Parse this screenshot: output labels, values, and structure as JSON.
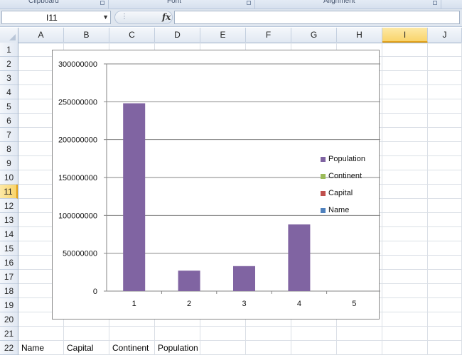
{
  "ribbon": {
    "groups": [
      {
        "label": "Clipboard"
      },
      {
        "label": "Font"
      },
      {
        "label": "Alignment"
      }
    ]
  },
  "formula_bar": {
    "name_box": "I11",
    "fx_label": "fx",
    "formula": ""
  },
  "sheet": {
    "columns": [
      "A",
      "B",
      "C",
      "D",
      "E",
      "F",
      "G",
      "H",
      "I",
      "J"
    ],
    "active_column": "I",
    "rows": [
      "1",
      "2",
      "3",
      "4",
      "5",
      "6",
      "7",
      "8",
      "9",
      "10",
      "11",
      "12",
      "13",
      "14",
      "15",
      "16",
      "17",
      "18",
      "19",
      "20",
      "21",
      "22"
    ],
    "active_row": "11",
    "row22": {
      "A": "Name",
      "B": "Capital",
      "C": "Continent",
      "D": "Population"
    }
  },
  "chart_data": {
    "type": "bar",
    "categories": [
      "1",
      "2",
      "3",
      "4",
      "5"
    ],
    "series": [
      {
        "name": "Population",
        "values": [
          248000000,
          27000000,
          33000000,
          88000000,
          0
        ],
        "color": "#8064a2"
      },
      {
        "name": "Continent",
        "values": [
          0,
          0,
          0,
          0,
          0
        ],
        "color": "#9bbb59"
      },
      {
        "name": "Capital",
        "values": [
          0,
          0,
          0,
          0,
          0
        ],
        "color": "#c0504d"
      },
      {
        "name": "Name",
        "values": [
          0,
          0,
          0,
          0,
          0
        ],
        "color": "#4f81bd"
      }
    ],
    "ylim": [
      0,
      300000000
    ],
    "yticks": [
      "0",
      "50000000",
      "100000000",
      "150000000",
      "200000000",
      "250000000",
      "300000000"
    ],
    "grid": true,
    "legend": "right",
    "title": "",
    "xlabel": "",
    "ylabel": ""
  }
}
